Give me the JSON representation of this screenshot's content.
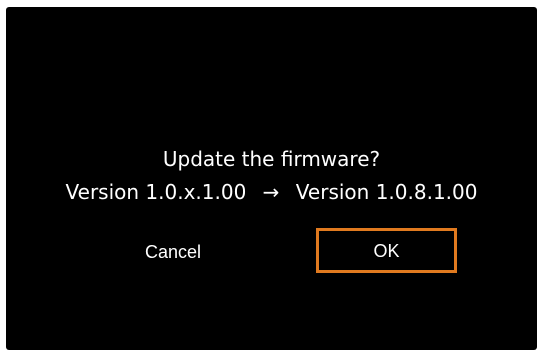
{
  "dialog": {
    "question": "Update the firmware?",
    "current_version": "Version 1.0.x.1.00",
    "arrow": "→",
    "new_version": "Version 1.0.8.1.00"
  },
  "buttons": {
    "cancel_label": "Cancel",
    "ok_label": "OK",
    "focus_color": "#e07a1f"
  }
}
